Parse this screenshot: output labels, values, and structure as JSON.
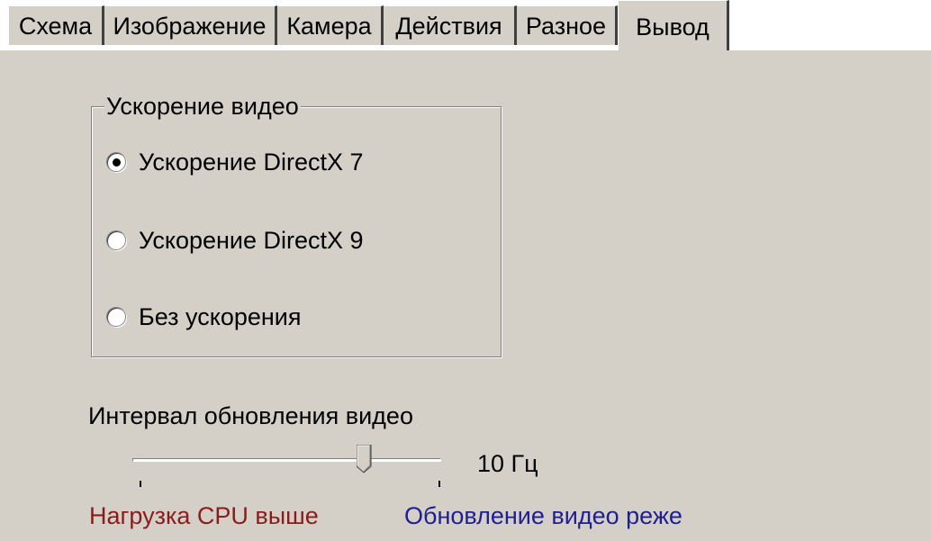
{
  "tabs": [
    {
      "label": "Схема",
      "active": false
    },
    {
      "label": "Изображение",
      "active": false
    },
    {
      "label": "Камера",
      "active": false
    },
    {
      "label": "Действия",
      "active": false
    },
    {
      "label": "Разное",
      "active": false
    },
    {
      "label": "Вывод",
      "active": true
    }
  ],
  "video_acceleration": {
    "title": "Ускорение видео",
    "options": [
      {
        "label": "Ускорение DirectX 7",
        "selected": true
      },
      {
        "label": "Ускорение DirectX 9",
        "selected": false
      },
      {
        "label": "Без ускорения",
        "selected": false
      }
    ]
  },
  "refresh_interval": {
    "label": "Интервал обновления видео",
    "value_text": "10 Гц",
    "position_fraction": 0.75,
    "hint_left": "Нагрузка CPU выше",
    "hint_right": "Обновление видео реже"
  },
  "colors": {
    "background": "#d4d0c8",
    "hint_left": "#8b1c1c",
    "hint_right": "#1f1f8f"
  }
}
